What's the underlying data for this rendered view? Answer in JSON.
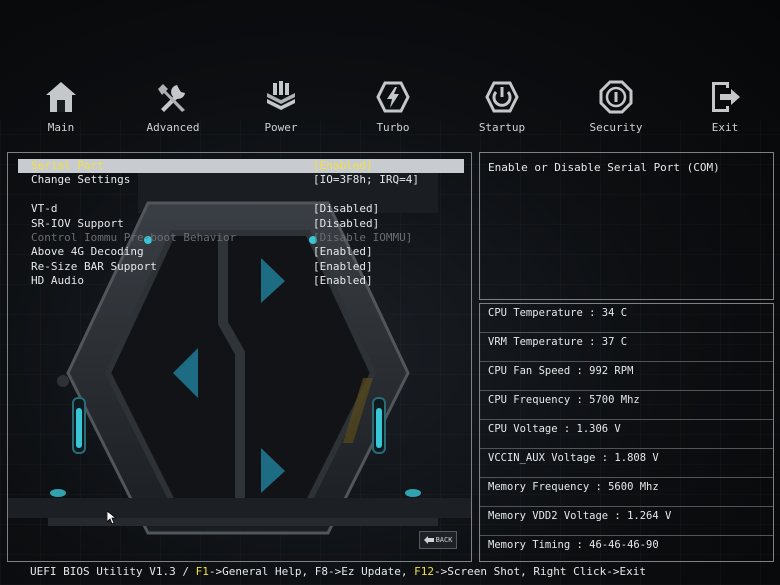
{
  "nav": {
    "items": [
      {
        "label": "Main",
        "icon": "home-icon"
      },
      {
        "label": "Advanced",
        "icon": "tools-icon"
      },
      {
        "label": "Power",
        "icon": "chip-stack-icon"
      },
      {
        "label": "Turbo",
        "icon": "lightning-icon"
      },
      {
        "label": "Startup",
        "icon": "power-icon"
      },
      {
        "label": "Security",
        "icon": "shield-icon"
      },
      {
        "label": "Exit",
        "icon": "exit-icon"
      }
    ]
  },
  "menu": {
    "rows": [
      {
        "label": "Serial Port",
        "value": "[Enabled]"
      },
      {
        "label": "Change Settings",
        "value": "[IO=3F8h; IRQ=4]"
      },
      {
        "label": "VT-d",
        "value": "[Disabled]"
      },
      {
        "label": "SR-IOV Support",
        "value": "[Disabled]"
      },
      {
        "label": "Control Iommu Pre-boot Behavior",
        "value": "[Disable IOMMU]"
      },
      {
        "label": "Above 4G Decoding",
        "value": "[Enabled]"
      },
      {
        "label": "Re-Size BAR Support",
        "value": "[Enabled]"
      },
      {
        "label": "HD Audio",
        "value": "[Enabled]"
      }
    ],
    "back_label": "BACK"
  },
  "help": {
    "text": "Enable or Disable Serial Port (COM)"
  },
  "monitor": {
    "items": [
      "CPU Temperature : 34 C",
      "VRM Temperature : 37 C",
      "CPU Fan Speed : 992 RPM",
      "CPU Frequency : 5700 Mhz",
      "CPU Voltage : 1.306 V",
      "VCCIN_AUX Voltage : 1.808 V",
      "Memory Frequency : 5600 Mhz",
      "Memory VDD2 Voltage : 1.264 V",
      "Memory Timing : 46-46-46-90"
    ]
  },
  "status": {
    "version": "UEFI BIOS Utility V1.3 / ",
    "f1_key": "F1",
    "f1_text": "->General Help, F8->Ez Update, ",
    "f12_key": "F12",
    "f12_text": "->Screen Shot, Right Click->Exit"
  },
  "colors": {
    "highlight": "#f0e040",
    "selected_bg": "#c8cbcf",
    "accent_cyan": "#39c6d6"
  }
}
